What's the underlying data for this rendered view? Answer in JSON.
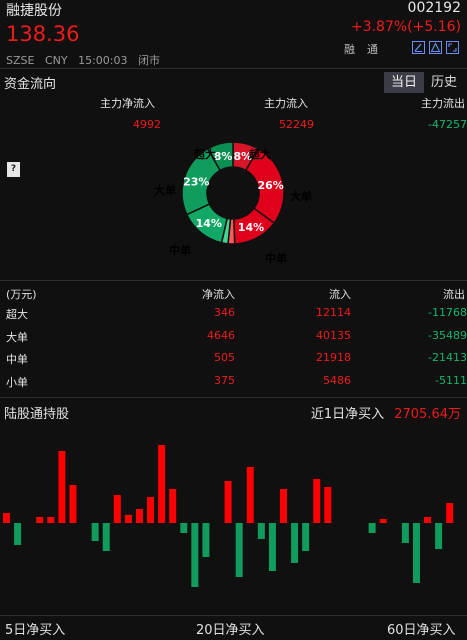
{
  "header": {
    "name": "融捷股份",
    "code": "002192",
    "price": "138.36",
    "change": "+3.87%(+5.16)",
    "meta": [
      "SZSE",
      "CNY",
      "15:00:03",
      "闭市"
    ],
    "rong": "融",
    "tong": "通",
    "icons": [
      "edit-icon",
      "alert-icon",
      "fullscreen-icon"
    ]
  },
  "fund_flow": {
    "title": "资金流向",
    "tabs": [
      "当日",
      "历史"
    ],
    "summary": [
      {
        "label": "主力净流入",
        "value": "4992"
      },
      {
        "label": "主力流入",
        "value": "52249"
      },
      {
        "label": "主力流出",
        "value": "-47257"
      }
    ],
    "help": "?",
    "donut": {
      "labels": {
        "left_top": "超大",
        "right_top": "超大",
        "left_mid": "大单",
        "right_mid": "大单",
        "left_bottom": "中单",
        "right_bottom": "中单"
      },
      "slices": [
        {
          "name": "超大",
          "side": "inflow",
          "pct": "8%",
          "value": 8,
          "color": "#d8162a"
        },
        {
          "name": "大单",
          "side": "inflow",
          "pct": "26%",
          "value": 26,
          "color": "#e0001b"
        },
        {
          "name": "中单",
          "side": "inflow",
          "pct": "14%",
          "value": 14,
          "color": "#e0001b"
        },
        {
          "name": "小单",
          "side": "inflow",
          "value": 2,
          "color": "#ff5a5a"
        },
        {
          "name": "小单",
          "side": "outflow",
          "value": 2,
          "color": "#42d38f"
        },
        {
          "name": "中单",
          "side": "outflow",
          "pct": "14%",
          "value": 14,
          "color": "#11a865"
        },
        {
          "name": "大单",
          "side": "outflow",
          "pct": "23%",
          "value": 23,
          "color": "#0f9c5c"
        },
        {
          "name": "超大",
          "side": "outflow",
          "pct": "8%",
          "value": 8,
          "color": "#0c8f52"
        }
      ]
    }
  },
  "table": {
    "headers": [
      "(万元)",
      "净流入",
      "流入",
      "流出"
    ],
    "rows": [
      {
        "name": "超大",
        "net": "346",
        "in": "12114",
        "out": "-11768"
      },
      {
        "name": "大单",
        "net": "4646",
        "in": "40135",
        "out": "-35489"
      },
      {
        "name": "中单",
        "net": "505",
        "in": "21918",
        "out": "-21413"
      },
      {
        "name": "小单",
        "net": "375",
        "in": "5486",
        "out": "-5111"
      }
    ]
  },
  "northbound": {
    "title": "陆股通持股",
    "net_label": "近1日净买入",
    "net_value": "2705.64万",
    "footer": [
      "5日净买入",
      "20日净买入",
      "60日净买入"
    ]
  },
  "chart_data": {
    "type": "bar",
    "title": "",
    "values": [
      10,
      -22,
      0,
      6,
      6,
      72,
      38,
      0,
      -18,
      -28,
      28,
      8,
      14,
      26,
      78,
      34,
      -10,
      -64,
      -34,
      0,
      42,
      -54,
      56,
      -16,
      -48,
      34,
      -40,
      -28,
      44,
      36,
      0,
      0,
      0,
      -10,
      4,
      0,
      -20,
      -60,
      6,
      -26,
      20,
      0
    ],
    "colors": {
      "positive": "#ff0000",
      "negative": "#0f9c5c"
    }
  }
}
